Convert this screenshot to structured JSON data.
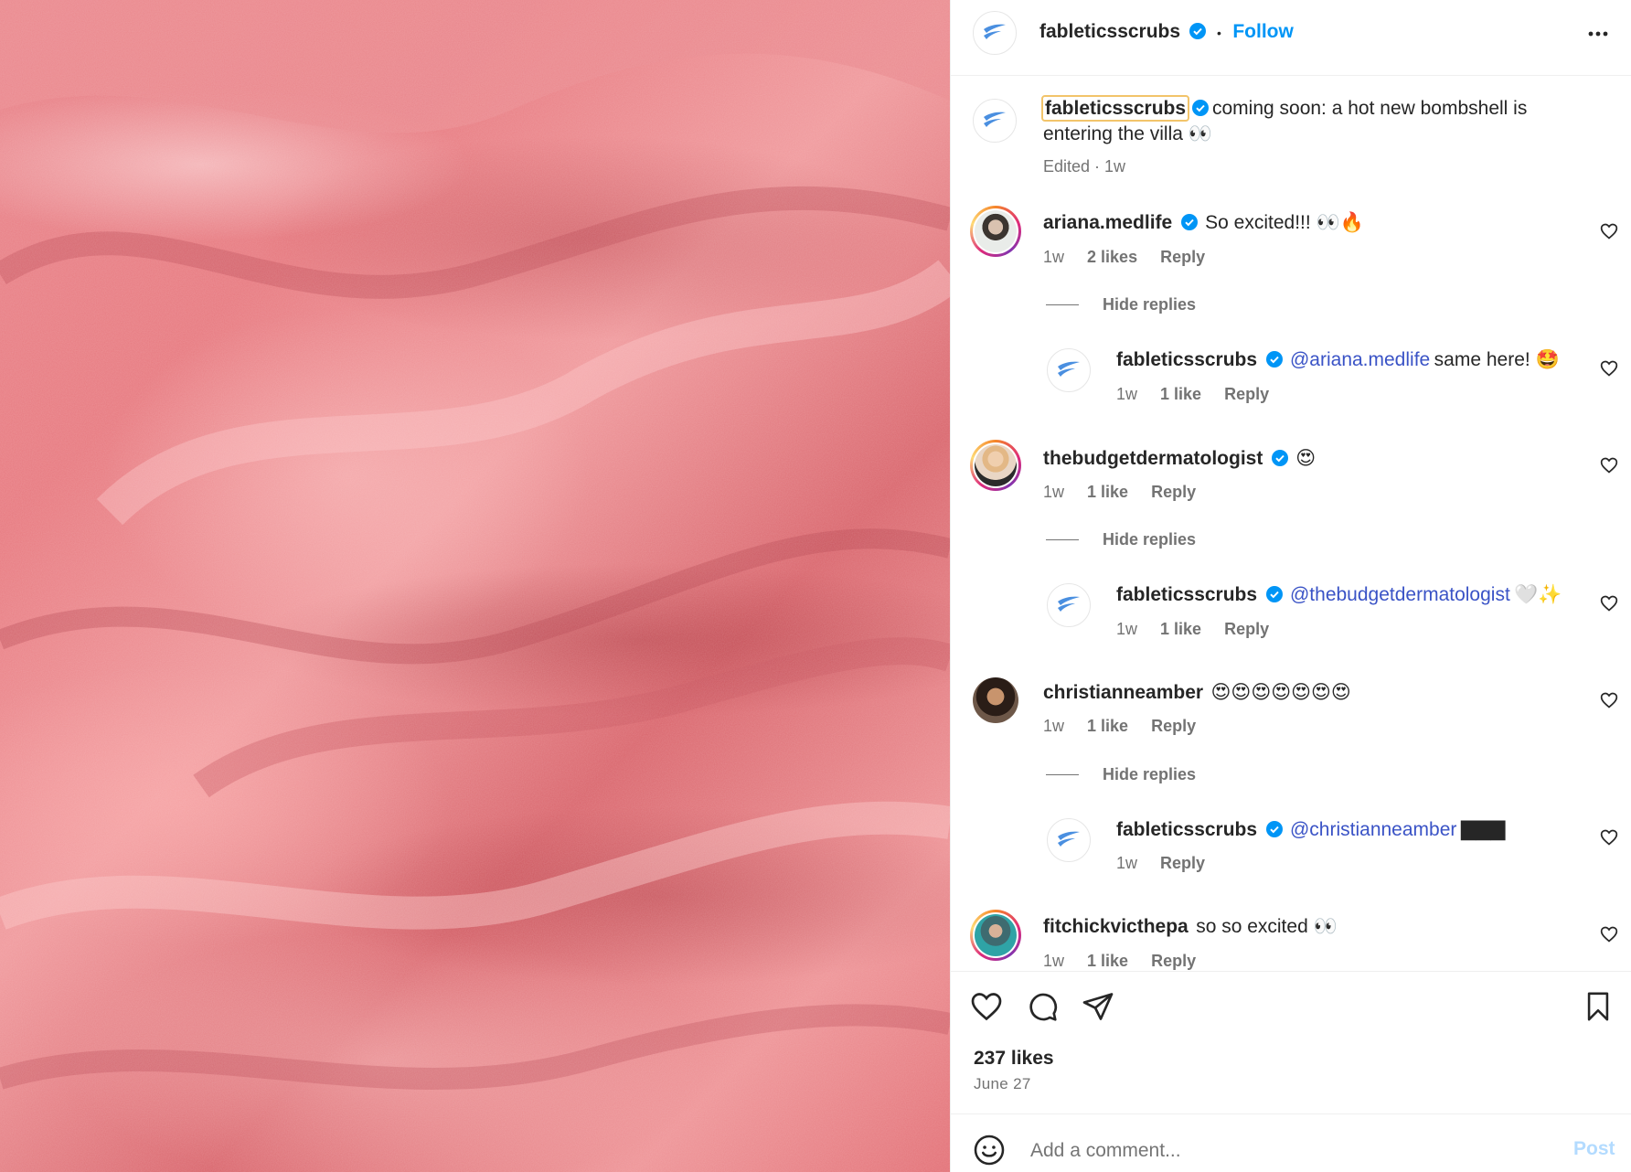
{
  "post": {
    "account": "fableticsscrubs",
    "follow_label": "Follow",
    "dot": "•",
    "caption": {
      "username": "fableticsscrubs",
      "text": "coming soon: a hot new bombshell is",
      "text_line2": "entering the villa 👀",
      "meta": "Edited · 1w"
    }
  },
  "comments": [
    {
      "username": "ariana.medlife",
      "text": "So excited!!! 👀🔥",
      "time": "1w",
      "likes": "2 likes",
      "reply": "Reply",
      "hide_replies": "Hide replies",
      "replies": [
        {
          "username": "fableticsscrubs",
          "mention": "@ariana.medlife",
          "text": "same here! 🤩",
          "time": "1w",
          "likes": "1 like",
          "reply": "Reply"
        }
      ]
    },
    {
      "username": "thebudgetdermatologist",
      "text": "😍",
      "time": "1w",
      "likes": "1 like",
      "reply": "Reply",
      "hide_replies": "Hide replies",
      "replies": [
        {
          "username": "fableticsscrubs",
          "mention": "@thebudgetdermatologist",
          "text": "🤍✨",
          "time": "1w",
          "likes": "1 like",
          "reply": "Reply"
        }
      ]
    },
    {
      "username": "christianneamber",
      "text": "😍😍😍😍😍😍😍",
      "time": "1w",
      "likes": "1 like",
      "reply": "Reply",
      "hide_replies": "Hide replies",
      "replies": [
        {
          "username": "fableticsscrubs",
          "mention": "@christianneamber",
          "text": "▇▇▇",
          "time": "1w",
          "reply": "Reply"
        }
      ]
    },
    {
      "username": "fitchickvicthepa",
      "text": "so so excited 👀",
      "time": "1w",
      "likes": "1 like",
      "reply": "Reply"
    }
  ],
  "engagement": {
    "likes": "237 likes",
    "date": "June 27"
  },
  "composer": {
    "placeholder": "Add a comment...",
    "post_label": "Post"
  },
  "colors": {
    "accent_blue": "#0095f6",
    "mention": "#3a53c6",
    "verified": "#0095f6",
    "muted": "#737373"
  }
}
